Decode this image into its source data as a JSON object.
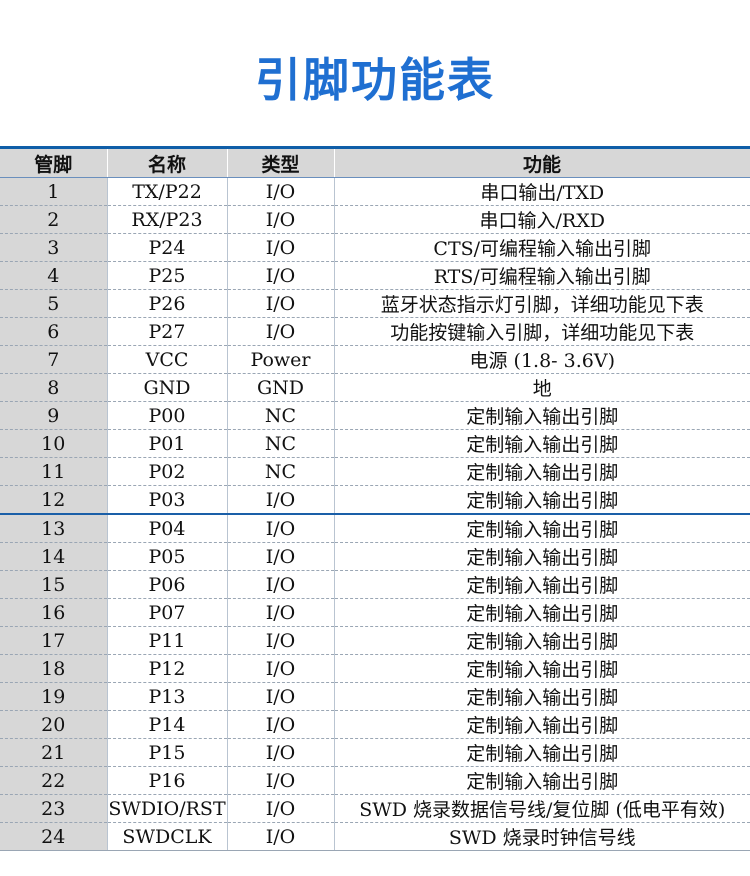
{
  "title": "引脚功能表",
  "table": {
    "headers": [
      "管脚",
      "名称",
      "类型",
      "功能"
    ],
    "rows": [
      [
        "1",
        "TX/P22",
        "I/O",
        "串口输出/TXD"
      ],
      [
        "2",
        "RX/P23",
        "I/O",
        "串口输入/RXD"
      ],
      [
        "3",
        "P24",
        "I/O",
        "CTS/可编程输入输出引脚"
      ],
      [
        "4",
        "P25",
        "I/O",
        "RTS/可编程输入输出引脚"
      ],
      [
        "5",
        "P26",
        "I/O",
        "蓝牙状态指示灯引脚，详细功能见下表"
      ],
      [
        "6",
        "P27",
        "I/O",
        "功能按键输入引脚，详细功能见下表"
      ],
      [
        "7",
        "VCC",
        "Power",
        "电源 (1.8- 3.6V)"
      ],
      [
        "8",
        "GND",
        "GND",
        "地"
      ],
      [
        "9",
        "P00",
        "NC",
        "定制输入输出引脚"
      ],
      [
        "10",
        "P01",
        "NC",
        "定制输入输出引脚"
      ],
      [
        "11",
        "P02",
        "NC",
        "定制输入输出引脚"
      ],
      [
        "12",
        "P03",
        "I/O",
        "定制输入输出引脚"
      ],
      [
        "13",
        "P04",
        "I/O",
        "定制输入输出引脚"
      ],
      [
        "14",
        "P05",
        "I/O",
        "定制输入输出引脚"
      ],
      [
        "15",
        "P06",
        "I/O",
        "定制输入输出引脚"
      ],
      [
        "16",
        "P07",
        "I/O",
        "定制输入输出引脚"
      ],
      [
        "17",
        "P11",
        "I/O",
        "定制输入输出引脚"
      ],
      [
        "18",
        "P12",
        "I/O",
        "定制输入输出引脚"
      ],
      [
        "19",
        "P13",
        "I/O",
        "定制输入输出引脚"
      ],
      [
        "20",
        "P14",
        "I/O",
        "定制输入输出引脚"
      ],
      [
        "21",
        "P15",
        "I/O",
        "定制输入输出引脚"
      ],
      [
        "22",
        "P16",
        "I/O",
        "定制输入输出引脚"
      ],
      [
        "23",
        "SWDIO/RST",
        "I/O",
        "SWD 烧录数据信号线/复位脚 (低电平有效)"
      ],
      [
        "24",
        "SWDCLK",
        "I/O",
        "SWD 烧录时钟信号线"
      ]
    ]
  },
  "colors": {
    "title": "#1f6fd1",
    "accent_line": "#0f5ea8",
    "header_bg": "#d7d7d7"
  }
}
